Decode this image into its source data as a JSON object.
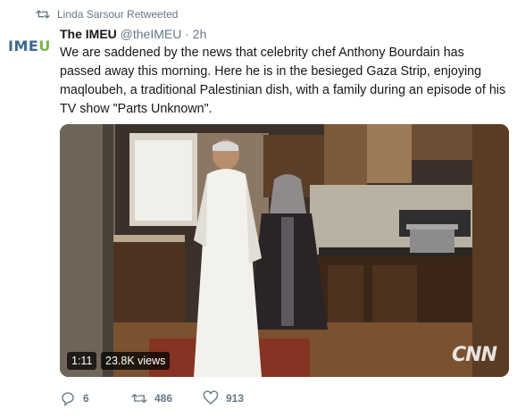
{
  "retweet": {
    "label": "Linda Sarsour Retweeted"
  },
  "author": {
    "avatar_text_a": "IME",
    "avatar_text_b": "U",
    "display_name": "The IMEU",
    "handle": "@theIMEU",
    "time": "· 2h"
  },
  "tweet": {
    "text": "We are saddened by the news that celebrity chef Anthony Bourdain has passed away this morning. Here he is in the besieged Gaza Strip, enjoying maqloubeh, a traditional Palestinian dish, with a family during an episode of his TV show \"Parts Unknown\"."
  },
  "video": {
    "duration": "1:11",
    "views": "23.8K views",
    "watermark": "CNN"
  },
  "actions": {
    "replies": "6",
    "retweets": "486",
    "likes": "913"
  },
  "colors": {
    "muted": "#657786",
    "imeu_blue": "#3a6a8a",
    "imeu_green": "#7ab648"
  },
  "icons": {
    "retweet": "retweet-icon",
    "reply": "reply-icon",
    "like": "heart-icon"
  }
}
